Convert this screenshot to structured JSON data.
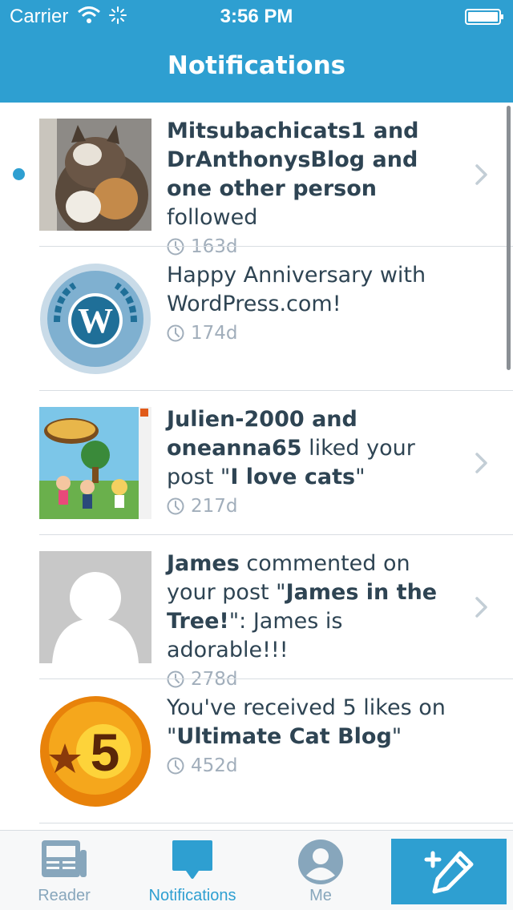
{
  "status_bar": {
    "carrier": "Carrier",
    "time": "3:56 PM"
  },
  "nav": {
    "title": "Notifications"
  },
  "notifications": [
    {
      "unread": true,
      "avatar": "cat-photo",
      "parts": [
        [
          "b",
          "Mitsubachicats1 and DrAnthonysBlog and one other person"
        ],
        [
          "t",
          " followed"
        ]
      ],
      "age": "163d",
      "chevron": true
    },
    {
      "unread": false,
      "avatar": "wordpress-anniversary-badge",
      "parts": [
        [
          "t",
          "Happy Anniversary with WordPress.com!"
        ]
      ],
      "age": "174d",
      "chevron": false
    },
    {
      "unread": false,
      "avatar": "animal-crossing-cover",
      "parts": [
        [
          "b",
          "Julien-2000 and oneanna65"
        ],
        [
          "t",
          " liked your post \""
        ],
        [
          "b",
          "I love cats"
        ],
        [
          "t",
          "\""
        ]
      ],
      "age": "217d",
      "chevron": true
    },
    {
      "unread": false,
      "avatar": "default-user-silhouette",
      "parts": [
        [
          "b",
          "James"
        ],
        [
          "t",
          " commented on your post \""
        ],
        [
          "b",
          "James in the Tree!"
        ],
        [
          "t",
          "\": James is adorable!!!"
        ]
      ],
      "age": "278d",
      "chevron": true
    },
    {
      "unread": false,
      "avatar": "five-likes-badge",
      "parts": [
        [
          "t",
          "You've received 5 likes on \""
        ],
        [
          "b",
          "Ultimate Cat Blog"
        ],
        [
          "t",
          "\""
        ]
      ],
      "age": "452d",
      "chevron": false
    }
  ],
  "badge_text": "5",
  "tabs": [
    {
      "label": "Reader",
      "icon": "reader-icon"
    },
    {
      "label": "Notifications",
      "icon": "notifications-icon",
      "active": true
    },
    {
      "label": "Me",
      "icon": "me-icon"
    }
  ],
  "compose": {
    "icon": "compose-icon"
  },
  "colors": {
    "accent": "#2e9fd1",
    "text": "#2e4453",
    "meta": "#a1aebb"
  }
}
